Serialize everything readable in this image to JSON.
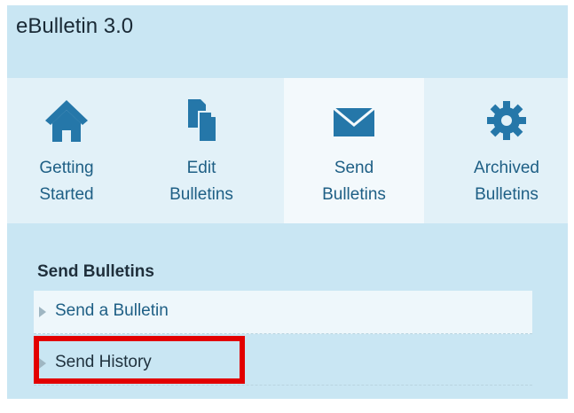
{
  "app": {
    "title": "eBulletin 3.0"
  },
  "nav": {
    "items": [
      {
        "line1": "Getting",
        "line2": "Started",
        "icon": "home-icon",
        "active": false
      },
      {
        "line1": "Edit",
        "line2": "Bulletins",
        "icon": "documents-icon",
        "active": false
      },
      {
        "line1": "Send",
        "line2": "Bulletins",
        "icon": "envelope-icon",
        "active": true
      },
      {
        "line1": "Archived",
        "line2": "Bulletins",
        "icon": "gear-icon",
        "active": false
      }
    ]
  },
  "section": {
    "title": "Send Bulletins",
    "items": [
      {
        "label": "Send a Bulletin"
      },
      {
        "label": "Send History"
      }
    ]
  },
  "colors": {
    "panel_bg": "#c9e6f3",
    "nav_bg": "#e2f1f8",
    "active_tab_bg": "#f3f9fc",
    "link": "#1e5f85",
    "icon": "#2577a9",
    "highlight_border": "#e20000"
  }
}
